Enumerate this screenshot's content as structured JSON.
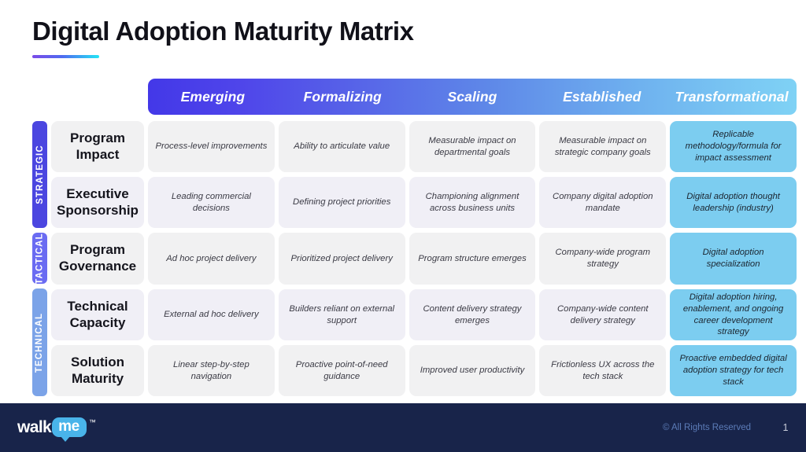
{
  "title": "Digital Adoption Maturity Matrix",
  "columns": [
    {
      "label": "Emerging"
    },
    {
      "label": "Formalizing"
    },
    {
      "label": "Scaling"
    },
    {
      "label": "Established"
    },
    {
      "label": "Transformational"
    }
  ],
  "categories": [
    {
      "label": "STRATEGIC",
      "color": "#4B46E0"
    },
    {
      "label": "TACTICAL",
      "color": "#6A6BF2"
    },
    {
      "label": "TECHNICAL",
      "color": "#7BA3E8"
    }
  ],
  "rows": [
    {
      "label": "Program Impact",
      "cells": [
        "Process-level improvements",
        "Ability to articulate value",
        "Measurable impact on departmental goals",
        "Measurable impact on strategic company goals",
        "Replicable methodology/formula for impact assessment"
      ]
    },
    {
      "label": "Executive Sponsorship",
      "cells": [
        "Leading commercial decisions",
        "Defining project priorities",
        "Championing alignment across business units",
        "Company digital adoption mandate",
        "Digital adoption thought leadership (industry)"
      ]
    },
    {
      "label": "Program Governance",
      "cells": [
        "Ad hoc project delivery",
        "Prioritized project delivery",
        "Program structure emerges",
        "Company-wide program strategy",
        "Digital adoption specialization"
      ]
    },
    {
      "label": "Technical Capacity",
      "cells": [
        "External ad hoc delivery",
        "Builders reliant on external support",
        "Content delivery strategy emerges",
        "Company-wide content delivery strategy",
        "Digital adoption hiring, enablement, and ongoing career development strategy"
      ]
    },
    {
      "label": "Solution Maturity",
      "cells": [
        "Linear step-by-step navigation",
        "Proactive point-of-need guidance",
        "Improved user productivity",
        "Frictionless UX across the tech stack",
        "Proactive embedded digital adoption strategy for tech stack"
      ]
    }
  ],
  "footer": {
    "logo_text": "walk",
    "logo_bubble_text": "me",
    "trademark": "™",
    "copyright": "© All Rights Reserved",
    "page_number": "1"
  },
  "theme": {
    "highlight_color": "#7CCDF0",
    "row_gray": "#F1F1F2",
    "row_lavender": "#F0EFF6",
    "footer_bg": "#18244A",
    "accent_gradient_start": "#7B4BE8",
    "accent_gradient_end": "#23E5F5"
  }
}
